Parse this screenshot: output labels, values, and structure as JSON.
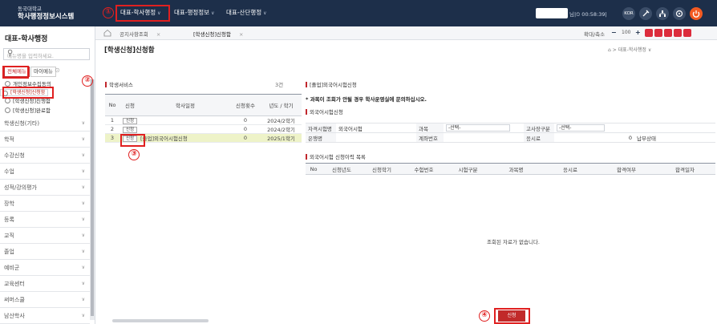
{
  "header": {
    "school_name": "동국대학교",
    "system_name": "학사행정정보시스템",
    "menus": [
      {
        "label": "대표-학사행정"
      },
      {
        "label": "대표-행정정보"
      },
      {
        "label": "대표-산단행정"
      }
    ],
    "user_time": "님|⏲ 00:58:39|",
    "lang_label": "KOR"
  },
  "callouts": [
    "①",
    "②",
    "③",
    "④"
  ],
  "sidebar": {
    "title": "대표-학사행정",
    "search_placeholder": "메뉴명을 입력하세요.",
    "tabs": [
      {
        "label": "전체메뉴"
      },
      {
        "label": "마이메뉴"
      }
    ],
    "subitems": [
      {
        "label": "개인정보수집동의"
      },
      {
        "label": "[학생신청]신청함"
      },
      {
        "label": "[학생신청]진행함"
      },
      {
        "label": "[학생신청]완료함"
      }
    ],
    "items": [
      {
        "label": "학생신청(기타)"
      },
      {
        "label": "학적"
      },
      {
        "label": "수강신청"
      },
      {
        "label": "수업"
      },
      {
        "label": "성적/강의평가"
      },
      {
        "label": "장학"
      },
      {
        "label": "등록"
      },
      {
        "label": "교직"
      },
      {
        "label": "졸업"
      },
      {
        "label": "예비군"
      },
      {
        "label": "교육센터"
      },
      {
        "label": "써머스쿨"
      },
      {
        "label": "남산학사"
      }
    ]
  },
  "tabs": {
    "items": [
      {
        "label": "공지사항조회"
      },
      {
        "label": "[학생신청]신청함"
      }
    ],
    "zoom_label": "확대/축소",
    "zoom_value": "100"
  },
  "page": {
    "title": "[학생신청]신청함",
    "breadcrumb": "대표-학사행정"
  },
  "service_panel": {
    "title": "학생서비스",
    "count": "3건",
    "columns": [
      "No",
      "신청",
      "학사일정",
      "신청횟수",
      "년도 / 학기"
    ],
    "button_label": "신청",
    "rows": [
      {
        "no": "1",
        "name": "",
        "count": "0",
        "term": "2024/2학기"
      },
      {
        "no": "2",
        "name": "",
        "count": "0",
        "term": "2024/2학기"
      },
      {
        "no": "3",
        "name": "[졸업]외국어시험신청",
        "count": "0",
        "term": "2025/1학기"
      }
    ]
  },
  "detail": {
    "title": "[졸업]외국어시험신청",
    "notice": "* 과목이 조회가 안될 경우 학사운영실에 문의하십시오.",
    "form_title": "외국어시험신청",
    "fields": {
      "type_label": "자격시험명",
      "type_value": "외국어시험",
      "subject_label": "과목",
      "subject_value": "-선택-",
      "grade_label": "고사장구분",
      "grade_value": "-선택-",
      "bank_label": "은행명",
      "account_label": "계좌번호",
      "fee_label": "응시료",
      "fee_value": "0",
      "pay_label": "납부상태"
    },
    "history_title": "외국어시험 신청이력 목록",
    "history_columns": [
      "No",
      "신청년도",
      "신청학기",
      "수험번호",
      "시험구분",
      "과목명",
      "응시료",
      "합격여부",
      "합격일자"
    ],
    "empty_message": "조회된 자료가 없습니다.",
    "apply_button": "신청"
  }
}
